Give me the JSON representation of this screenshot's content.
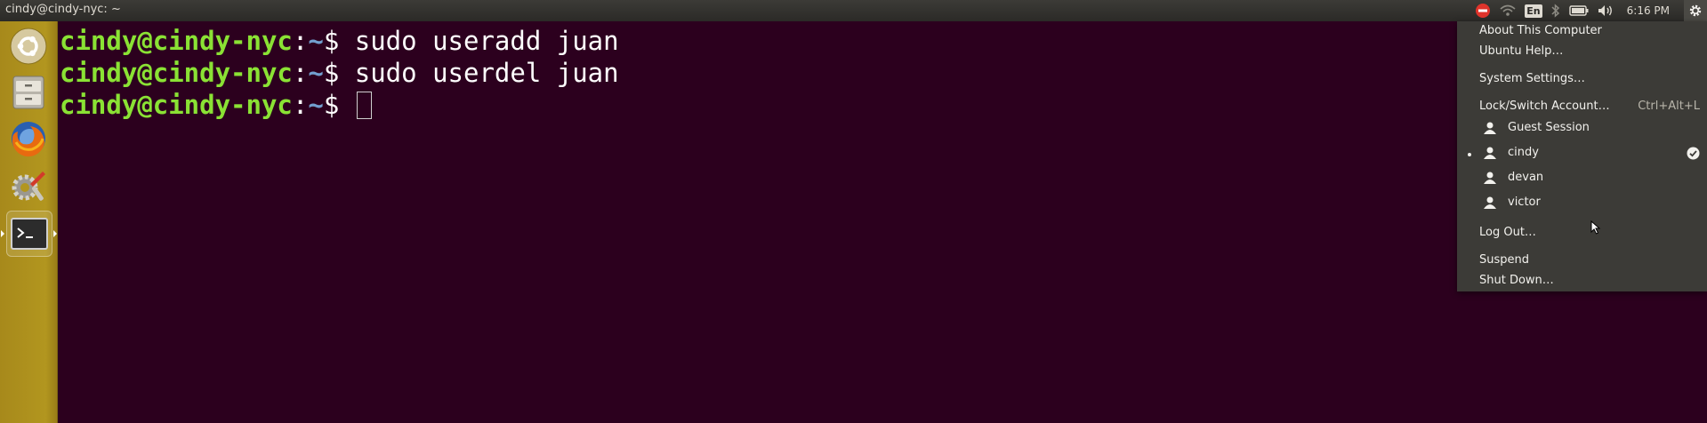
{
  "window": {
    "title": "cindy@cindy-nyc: ~"
  },
  "indicators": {
    "keyboard_layout": "En",
    "clock": "6:16 PM"
  },
  "colors": {
    "terminal_bg": "#2c001e",
    "prompt_user": "#8ae234",
    "prompt_path": "#729fcf",
    "launcher": "#b2961f",
    "menu_bg": "#3c3b37"
  },
  "launcher": {
    "items": [
      {
        "name": "Dash",
        "icon": "ubuntu-logo-icon"
      },
      {
        "name": "Files",
        "icon": "file-cabinet-icon"
      },
      {
        "name": "Firefox",
        "icon": "firefox-icon"
      },
      {
        "name": "System Settings",
        "icon": "settings-tools-icon"
      },
      {
        "name": "Terminal",
        "icon": "terminal-icon"
      }
    ]
  },
  "terminal": {
    "lines": [
      {
        "user": "cindy@cindy-nyc",
        "sep": ":",
        "path": "~",
        "dollar": "$ ",
        "cmd": "sudo useradd juan"
      },
      {
        "user": "cindy@cindy-nyc",
        "sep": ":",
        "path": "~",
        "dollar": "$ ",
        "cmd": "sudo userdel juan"
      },
      {
        "user": "cindy@cindy-nyc",
        "sep": ":",
        "path": "~",
        "dollar": "$ ",
        "cmd": ""
      }
    ]
  },
  "session_menu": {
    "about": "About This Computer",
    "help": "Ubuntu Help…",
    "settings": "System Settings…",
    "lock": "Lock/Switch Account…",
    "lock_accel": "Ctrl+Alt+L",
    "users": [
      {
        "name": "Guest Session"
      },
      {
        "name": "cindy"
      },
      {
        "name": "devan"
      },
      {
        "name": "victor"
      }
    ],
    "logout": "Log Out…",
    "suspend": "Suspend",
    "shutdown": "Shut Down…"
  }
}
